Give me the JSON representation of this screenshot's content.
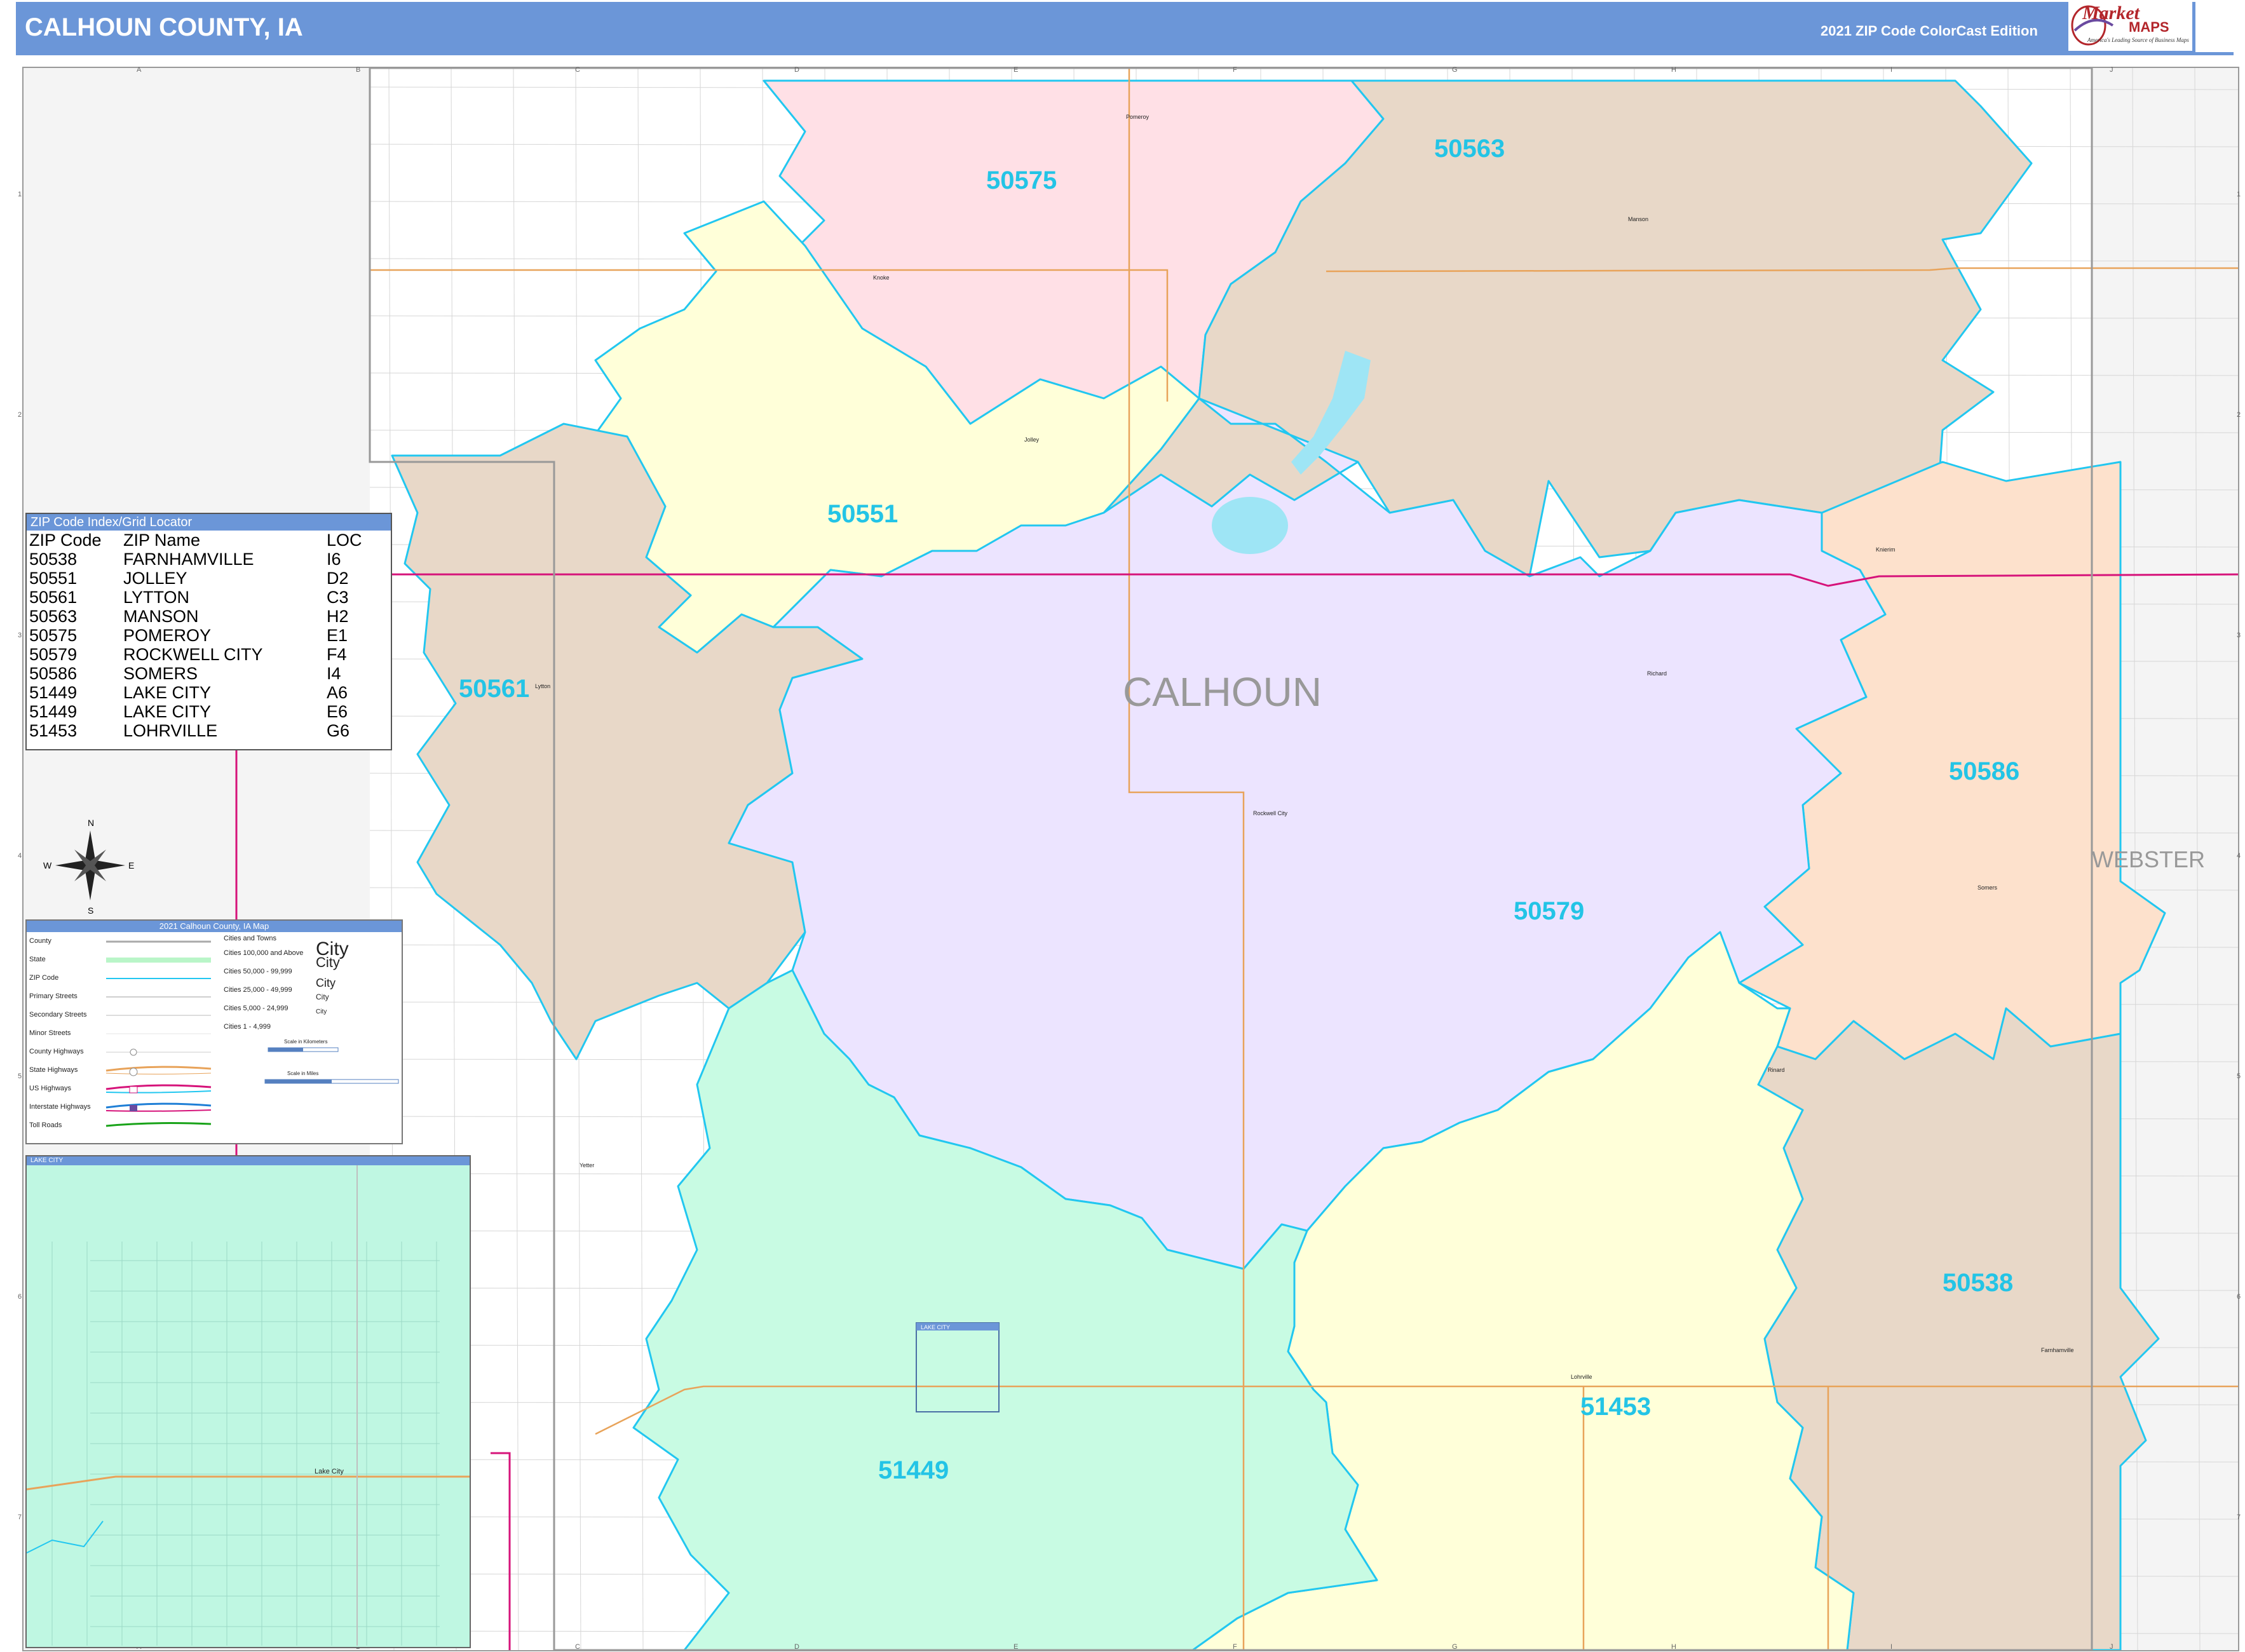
{
  "header": {
    "title": "CALHOUN COUNTY, IA",
    "edition": "2021 ZIP Code ColorCast Edition"
  },
  "logo": {
    "name_part1": "Market",
    "name_part2": "MAPS",
    "tagline": "America's Leading Source of Business Maps"
  },
  "grid": {
    "columns": [
      "A",
      "B",
      "C",
      "D",
      "E",
      "F",
      "G",
      "H",
      "I",
      "J"
    ],
    "rows": [
      "1",
      "2",
      "3",
      "4",
      "5",
      "6",
      "7"
    ]
  },
  "zip_index": {
    "title": "ZIP Code Index/Grid Locator",
    "headers": [
      "ZIP Code",
      "ZIP Name",
      "LOC"
    ],
    "rows": [
      [
        "50538",
        "FARNHAMVILLE",
        "I6"
      ],
      [
        "50551",
        "JOLLEY",
        "D2"
      ],
      [
        "50561",
        "LYTTON",
        "C3"
      ],
      [
        "50563",
        "MANSON",
        "H2"
      ],
      [
        "50575",
        "POMEROY",
        "E1"
      ],
      [
        "50579",
        "ROCKWELL CITY",
        "F4"
      ],
      [
        "50586",
        "SOMERS",
        "I4"
      ],
      [
        "51449",
        "LAKE CITY",
        "A6"
      ],
      [
        "51449",
        "LAKE CITY",
        "E6"
      ],
      [
        "51453",
        "LOHRVILLE",
        "G6"
      ]
    ]
  },
  "legend": {
    "title": "2021 Calhoun County, IA Map",
    "left_items": [
      "County",
      "State",
      "ZIP Code",
      "Primary Streets",
      "Secondary Streets",
      "Minor Streets",
      "County Highways",
      "State Highways",
      "US Highways",
      "Interstate Highways",
      "Toll Roads"
    ],
    "cities_header": "Cities and Towns",
    "city_classes": [
      "Cities 100,000 and Above",
      "Cities 50,000 - 99,999",
      "Cities 25,000 - 49,999",
      "Cities 5,000 - 24,999",
      "Cities 1 - 4,999"
    ],
    "city_samples": [
      "City",
      "City",
      "City",
      "City",
      "City"
    ],
    "scale_km": "Scale in Kilometers",
    "scale_mi": "Scale in Miles"
  },
  "compass": {
    "n": "N",
    "s": "S",
    "e": "E",
    "w": "W"
  },
  "inset": {
    "title": "LAKE CITY",
    "town_label": "Lake City"
  },
  "map": {
    "county_label": "CALHOUN",
    "neighbor_label": "WEBSTER",
    "zip_labels": [
      "50575",
      "50563",
      "50551",
      "50561",
      "50586",
      "50579",
      "50538",
      "51453",
      "51449"
    ],
    "towns": [
      "Pomeroy",
      "Manson",
      "Knoke",
      "Jolley",
      "Knierim",
      "Lytton",
      "Richard",
      "Rockwell City",
      "Somers",
      "Rinard",
      "Yetter",
      "Lohrville",
      "Farnhamville",
      "Lake City"
    ],
    "inset_marker": "LAKE CITY",
    "colors": {
      "pink": "#ffe0e6",
      "tan": "#e8d8c8",
      "yellow": "#ffffd9",
      "lavender": "#ece4ff",
      "peach": "#fde1cc",
      "mint": "#c8fbe3",
      "zip_boundary": "#22c7f0",
      "us_highway": "#d6137a",
      "state_highway": "#e8a35a",
      "water": "#9ee5f5",
      "zip_label": "#23c4e6"
    }
  }
}
